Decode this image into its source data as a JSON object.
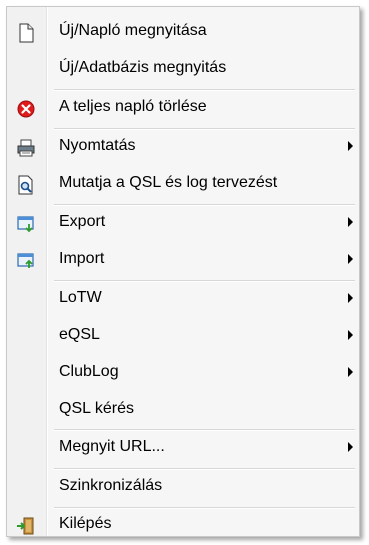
{
  "menu": {
    "items": [
      {
        "label": "Új/Napló megnyitása",
        "icon": "new-document-icon"
      },
      {
        "label": "Új/Adatbázis megnyitás",
        "icon": ""
      },
      {
        "label": "A teljes napló törlése",
        "icon": "delete-icon"
      },
      {
        "label": "Nyomtatás",
        "icon": "printer-icon",
        "submenu": true
      },
      {
        "label": "Mutatja a QSL és log tervezést",
        "icon": "print-preview-icon"
      },
      {
        "label": "Export",
        "icon": "export-icon",
        "submenu": true
      },
      {
        "label": "Import",
        "icon": "import-icon",
        "submenu": true
      },
      {
        "label": "LoTW",
        "icon": "",
        "submenu": true
      },
      {
        "label": "eQSL",
        "icon": "",
        "submenu": true
      },
      {
        "label": "ClubLog",
        "icon": "",
        "submenu": true
      },
      {
        "label": "QSL kérés",
        "icon": ""
      },
      {
        "label": "Megnyit URL...",
        "icon": "",
        "submenu": true
      },
      {
        "label": "Szinkronizálás",
        "icon": ""
      },
      {
        "label": "Kilépés",
        "icon": "exit-icon"
      }
    ]
  },
  "colors": {
    "delete": "#e01b1b",
    "gutter": "#f1f1f1",
    "menu_bg": "#f6f6f6"
  }
}
